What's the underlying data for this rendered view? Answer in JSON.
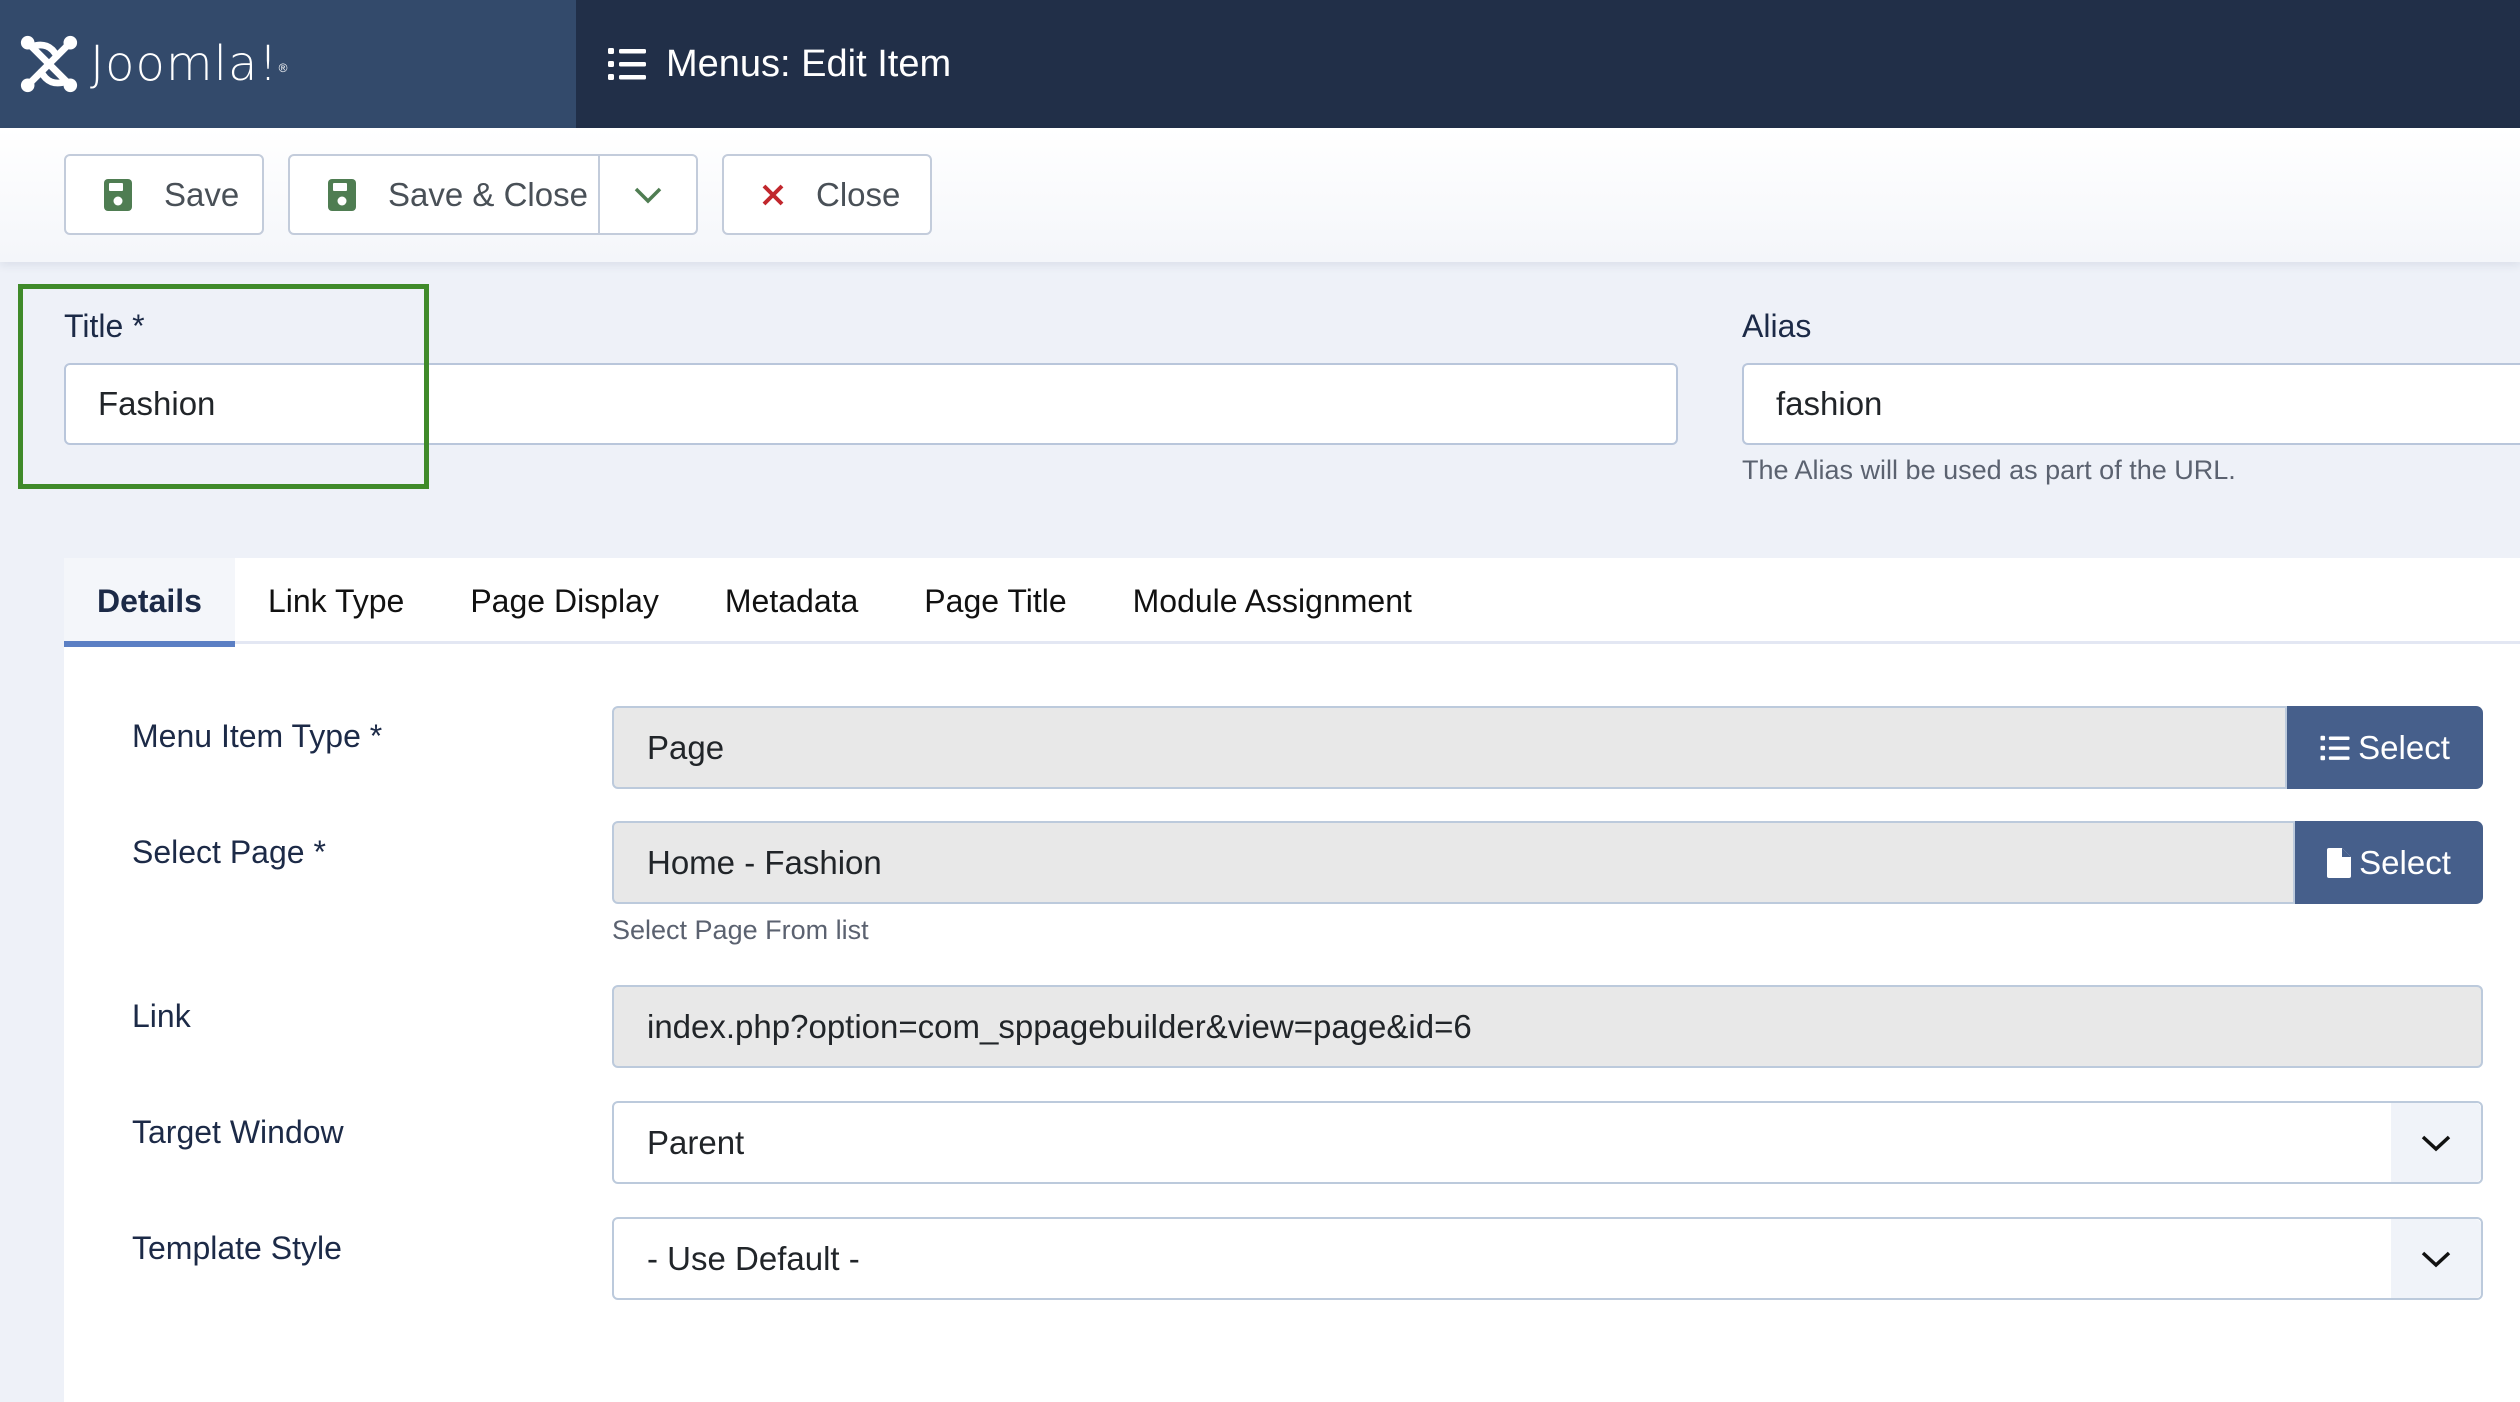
{
  "header": {
    "brand": "Joomla!",
    "brand_reg": "®",
    "page_title": "Menus: Edit Item",
    "page_icon": "list-icon"
  },
  "toolbar": {
    "save_label": "Save",
    "save_close_label": "Save & Close",
    "close_label": "Close",
    "save_icon": "floppy-disk-icon",
    "dropdown_icon": "chevron-down-icon",
    "close_icon": "x-icon"
  },
  "title_field": {
    "label": "Title *",
    "value": "Fashion"
  },
  "alias_field": {
    "label": "Alias",
    "value": "fashion",
    "help": "The Alias will be used as part of the URL."
  },
  "tabs": [
    {
      "label": "Details",
      "active": true
    },
    {
      "label": "Link Type",
      "active": false
    },
    {
      "label": "Page Display",
      "active": false
    },
    {
      "label": "Metadata",
      "active": false
    },
    {
      "label": "Page Title",
      "active": false
    },
    {
      "label": "Module Assignment",
      "active": false
    }
  ],
  "details": {
    "menu_item_type": {
      "label": "Menu Item Type *",
      "value": "Page",
      "button": "Select",
      "button_icon": "list-icon"
    },
    "select_page": {
      "label": "Select Page *",
      "value": "Home - Fashion",
      "button": "Select",
      "button_icon": "file-icon",
      "help": "Select Page From list"
    },
    "link": {
      "label": "Link",
      "value": "index.php?option=com_sppagebuilder&view=page&id=6"
    },
    "target_window": {
      "label": "Target Window",
      "value": "Parent"
    },
    "template_style": {
      "label": "Template Style",
      "value": "- Use Default -"
    }
  },
  "colors": {
    "header_bg": "#212f48",
    "logo_bg": "#334a6b",
    "primary_button": "#465f8b",
    "save_icon": "#4f7d52",
    "close_icon": "#c1272d",
    "highlight": "#3f8a2a",
    "active_tab_underline": "#5b7fc4"
  }
}
